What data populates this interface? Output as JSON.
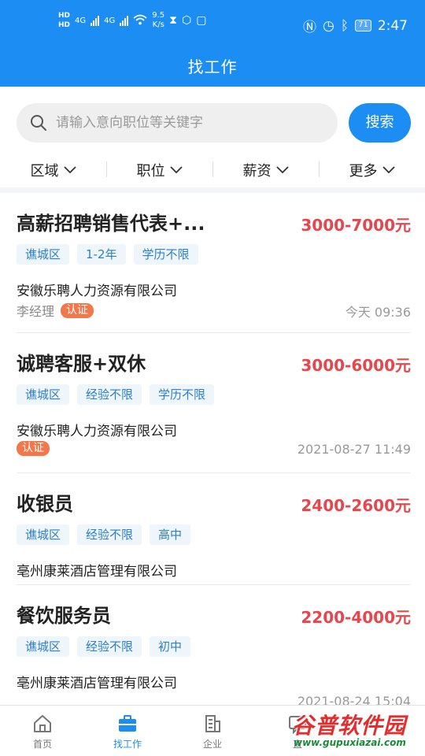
{
  "status_bar": {
    "hd1": "HD",
    "hd2": "HD",
    "net1": "4G",
    "net2": "4G",
    "speed_value": "9.5",
    "speed_unit": "K/s",
    "battery": "71",
    "time": "2:47"
  },
  "header": {
    "title": "找工作"
  },
  "search": {
    "placeholder": "请输入意向职位等关键字",
    "button_label": "搜索"
  },
  "filters": [
    {
      "label": "区域"
    },
    {
      "label": "职位"
    },
    {
      "label": "薪资"
    },
    {
      "label": "更多"
    }
  ],
  "jobs": [
    {
      "title": "高薪招聘销售代表+...",
      "salary": "3000-7000元",
      "tags": [
        "谯城区",
        "1-2年",
        "学历不限"
      ],
      "company": "安徽乐聘人力资源有限公司",
      "contact": "李经理",
      "badge": "认证",
      "time": "今天 09:36"
    },
    {
      "title": "诚聘客服+双休",
      "salary": "3000-6000元",
      "tags": [
        "谯城区",
        "经验不限",
        "学历不限"
      ],
      "company": "安徽乐聘人力资源有限公司",
      "contact": "",
      "badge": "认证",
      "time": "2021-08-27 11:49"
    },
    {
      "title": "收银员",
      "salary": "2400-2600元",
      "tags": [
        "谯城区",
        "经验不限",
        "高中"
      ],
      "company": "亳州康莱酒店管理有限公司",
      "contact": "",
      "badge": "",
      "time": ""
    },
    {
      "title": "餐饮服务员",
      "salary": "2200-4000元",
      "tags": [
        "谯城区",
        "经验不限",
        "初中"
      ],
      "company": "亳州康莱酒店管理有限公司",
      "contact": "",
      "badge": "",
      "time": "2021-08-24 15:04"
    }
  ],
  "bottom_nav": [
    {
      "label": "首页",
      "icon": "home-icon"
    },
    {
      "label": "找工作",
      "icon": "briefcase-icon",
      "active": true
    },
    {
      "label": "企业",
      "icon": "building-icon"
    },
    {
      "label": "直",
      "icon": "chat-icon"
    }
  ],
  "watermark": {
    "text": "谷普软件园",
    "url": "www.gupuxiazai.com"
  },
  "colors": {
    "primary": "#1c8df2",
    "salary": "#e8454c",
    "badge": "#f2774a",
    "tag_text": "#2d7fc8"
  }
}
